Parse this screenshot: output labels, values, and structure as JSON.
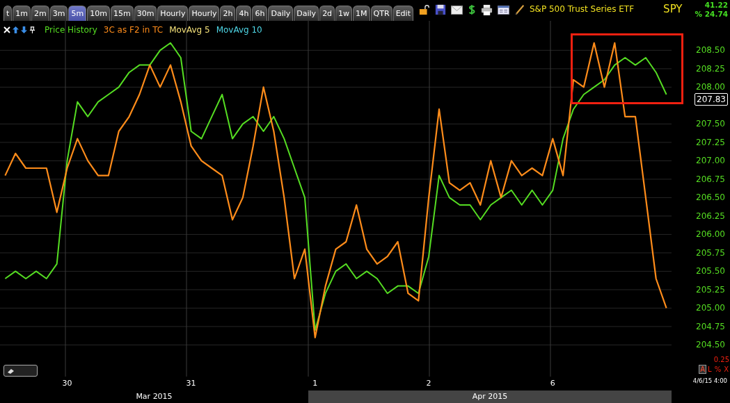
{
  "tabs": [
    {
      "label": "t",
      "selected": false
    },
    {
      "label": "1m",
      "selected": false
    },
    {
      "label": "2m",
      "selected": false
    },
    {
      "label": "3m",
      "selected": false
    },
    {
      "label": "5m",
      "selected": true
    },
    {
      "label": "10m",
      "selected": false
    },
    {
      "label": "15m",
      "selected": false
    },
    {
      "label": "30m",
      "selected": false
    },
    {
      "label": "Hourly",
      "selected": false
    },
    {
      "label": "Hourly",
      "selected": false
    },
    {
      "label": "2h",
      "selected": false
    },
    {
      "label": "4h",
      "selected": false
    },
    {
      "label": "6h",
      "selected": false
    },
    {
      "label": "Daily",
      "selected": false
    },
    {
      "label": "Daily",
      "selected": false
    },
    {
      "label": "2d",
      "selected": false
    },
    {
      "label": "1w",
      "selected": false
    },
    {
      "label": "1M",
      "selected": false
    },
    {
      "label": "QTR",
      "selected": false
    },
    {
      "label": "Edit",
      "selected": false
    }
  ],
  "instrument": {
    "name": "S&P 500 Trust Series ETF",
    "symbol": "SPY",
    "change": "41.22",
    "percent": "% 24.74"
  },
  "legend": [
    {
      "label": "MovAvg 5",
      "color": "#f5e27a"
    },
    {
      "label": "MovAvg 10",
      "color": "#4fd8e8"
    }
  ],
  "chart": {
    "price_tag": "207.83",
    "scale_reading": "0.25",
    "timestamp": "4/6/15 4:00",
    "scale_buttons": [
      {
        "label": "A",
        "selected": true
      },
      {
        "label": "L",
        "selected": false
      },
      {
        "label": "%",
        "selected": false
      },
      {
        "label": "X",
        "selected": false
      }
    ],
    "chart_data": {
      "type": "line",
      "categories": [
        null,
        null,
        null,
        null,
        null,
        null,
        "30",
        null,
        null,
        null,
        null,
        null,
        null,
        null,
        null,
        null,
        null,
        null,
        "31",
        null,
        null,
        null,
        null,
        null,
        null,
        null,
        null,
        null,
        null,
        null,
        "1",
        null,
        null,
        null,
        null,
        null,
        null,
        null,
        null,
        null,
        null,
        "2",
        null,
        null,
        null,
        null,
        null,
        null,
        null,
        null,
        null,
        null,
        null,
        "6",
        null,
        null,
        null,
        null,
        null,
        null,
        null,
        null,
        null,
        null,
        null
      ],
      "ylim": [
        204.07,
        208.9
      ],
      "grid": true,
      "yticks": [
        {
          "value": 204.5,
          "label": "204.50"
        },
        {
          "value": 204.75,
          "label": "204.75"
        },
        {
          "value": 205,
          "label": "205.00"
        },
        {
          "value": 205.25,
          "label": "205.25"
        },
        {
          "value": 205.5,
          "label": "205.50"
        },
        {
          "value": 205.75,
          "label": "205.75"
        },
        {
          "value": 206,
          "label": "206.00"
        },
        {
          "value": 206.25,
          "label": "206.25"
        },
        {
          "value": 206.5,
          "label": "206.50"
        },
        {
          "value": 206.75,
          "label": "206.75"
        },
        {
          "value": 207,
          "label": "207.00"
        },
        {
          "value": 207.25,
          "label": "207.25"
        },
        {
          "value": 207.5,
          "label": "207.50"
        },
        {
          "value": 208,
          "label": "208.00"
        },
        {
          "value": 208.25,
          "label": "208.25"
        },
        {
          "value": 208.5,
          "label": "208.50"
        }
      ],
      "series": [
        {
          "name": "Price History",
          "color": "#55dd22",
          "values": [
            205.4,
            205.5,
            205.4,
            205.5,
            205.4,
            205.6,
            207.0,
            207.8,
            207.6,
            207.8,
            207.9,
            208.0,
            208.2,
            208.3,
            208.3,
            208.5,
            208.6,
            208.4,
            207.4,
            207.3,
            207.6,
            207.9,
            207.3,
            207.5,
            207.6,
            207.4,
            207.6,
            207.3,
            206.9,
            206.5,
            204.7,
            205.2,
            205.5,
            205.6,
            205.4,
            205.5,
            205.4,
            205.2,
            205.3,
            205.3,
            205.2,
            205.7,
            206.8,
            206.5,
            206.4,
            206.4,
            206.2,
            206.4,
            206.5,
            206.6,
            206.4,
            206.6,
            206.4,
            206.6,
            207.3,
            207.7,
            207.9,
            208.0,
            208.1,
            208.3,
            208.4,
            208.3,
            208.4,
            208.2,
            207.9
          ]
        },
        {
          "name": "3C as F2 in TC",
          "color": "#ff8c1a",
          "values": [
            206.8,
            207.1,
            206.9,
            206.9,
            206.9,
            206.3,
            206.9,
            207.3,
            207.0,
            206.8,
            206.8,
            207.4,
            207.6,
            207.9,
            208.3,
            208.0,
            208.3,
            207.8,
            207.2,
            207.0,
            206.9,
            206.8,
            206.2,
            206.5,
            207.2,
            208.0,
            207.4,
            206.5,
            205.4,
            205.8,
            204.6,
            205.3,
            205.8,
            205.9,
            206.4,
            205.8,
            205.6,
            205.7,
            205.9,
            205.2,
            205.1,
            206.5,
            207.7,
            206.7,
            206.6,
            206.7,
            206.4,
            207.0,
            206.5,
            207.0,
            206.8,
            206.9,
            206.8,
            207.3,
            206.8,
            208.1,
            208.0,
            208.6,
            208.0,
            208.6,
            207.6,
            207.6,
            206.5,
            205.4,
            205.0
          ]
        }
      ]
    }
  },
  "months": [
    {
      "label": "Mar 2015",
      "highlighted": false
    },
    {
      "label": "Apr 2015",
      "highlighted": true
    }
  ]
}
